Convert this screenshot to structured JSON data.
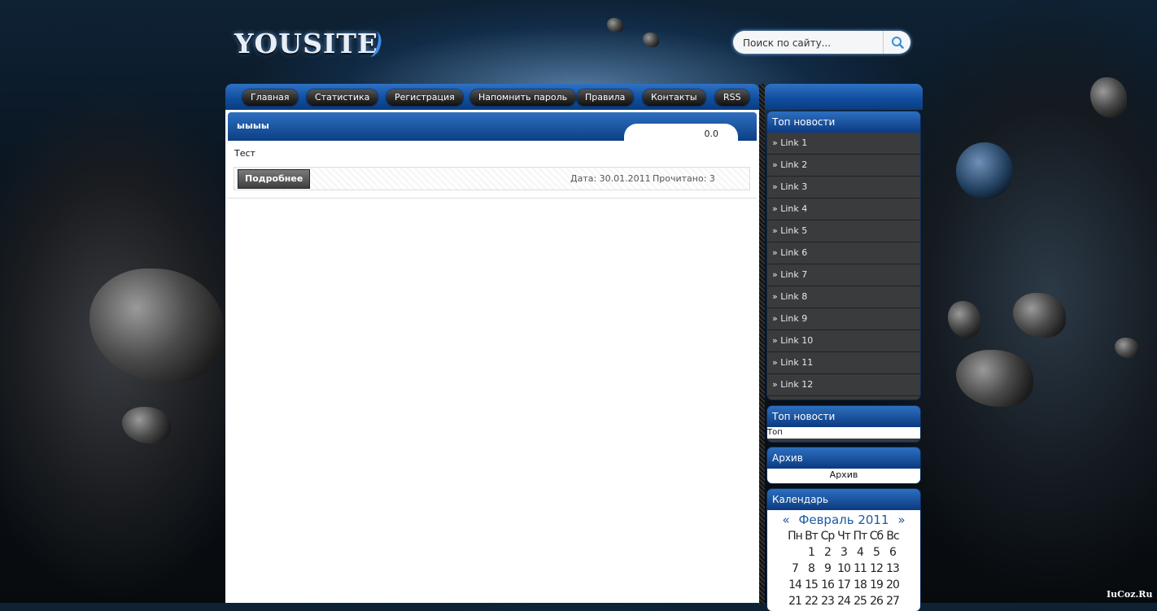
{
  "header": {
    "logo_text": "YOUSITE",
    "search_placeholder": "Поиск по сайту..."
  },
  "nav": {
    "items": [
      {
        "label": "Главная"
      },
      {
        "label": "Статистика"
      },
      {
        "label": "Регистрация"
      },
      {
        "label": "Напомнить пароль"
      },
      {
        "label": "Правила"
      },
      {
        "label": "Контакты"
      },
      {
        "label": "RSS"
      }
    ]
  },
  "post": {
    "title": "ыыыы",
    "rating": "0.0",
    "body": "Тест",
    "more_label": "Подробнее",
    "date": "Дата: 30.01.2011",
    "views": "Прочитано: 3"
  },
  "sidebar": {
    "top_news_title": "Топ новости",
    "links": [
      "» Link 1",
      "» Link 2",
      "» Link 3",
      "» Link 4",
      "» Link 5",
      "» Link 6",
      "» Link 7",
      "» Link 8",
      "» Link 9",
      "» Link 10",
      "» Link 11",
      "» Link 12"
    ],
    "top_news2_title": "Топ новости",
    "top_news2_text": "Топ",
    "archive_title": "Архив",
    "archive_text": "Архив",
    "calendar_title": "Календарь",
    "calendar_prev": "«",
    "calendar_month": "Февраль 2011",
    "calendar_next": "»",
    "calendar_days": [
      "Пн",
      "Вт",
      "Ср",
      "Чт",
      "Пт",
      "Сб",
      "Вс"
    ],
    "calendar_rows": [
      [
        "",
        "1",
        "2",
        "3",
        "4",
        "5",
        "6"
      ],
      [
        "7",
        "8",
        "9",
        "10",
        "11",
        "12",
        "13"
      ],
      [
        "14",
        "15",
        "16",
        "17",
        "18",
        "19",
        "20"
      ],
      [
        "21",
        "22",
        "23",
        "24",
        "25",
        "26",
        "27"
      ]
    ]
  },
  "footer": {
    "watermark": "IuCoz.Ru"
  }
}
